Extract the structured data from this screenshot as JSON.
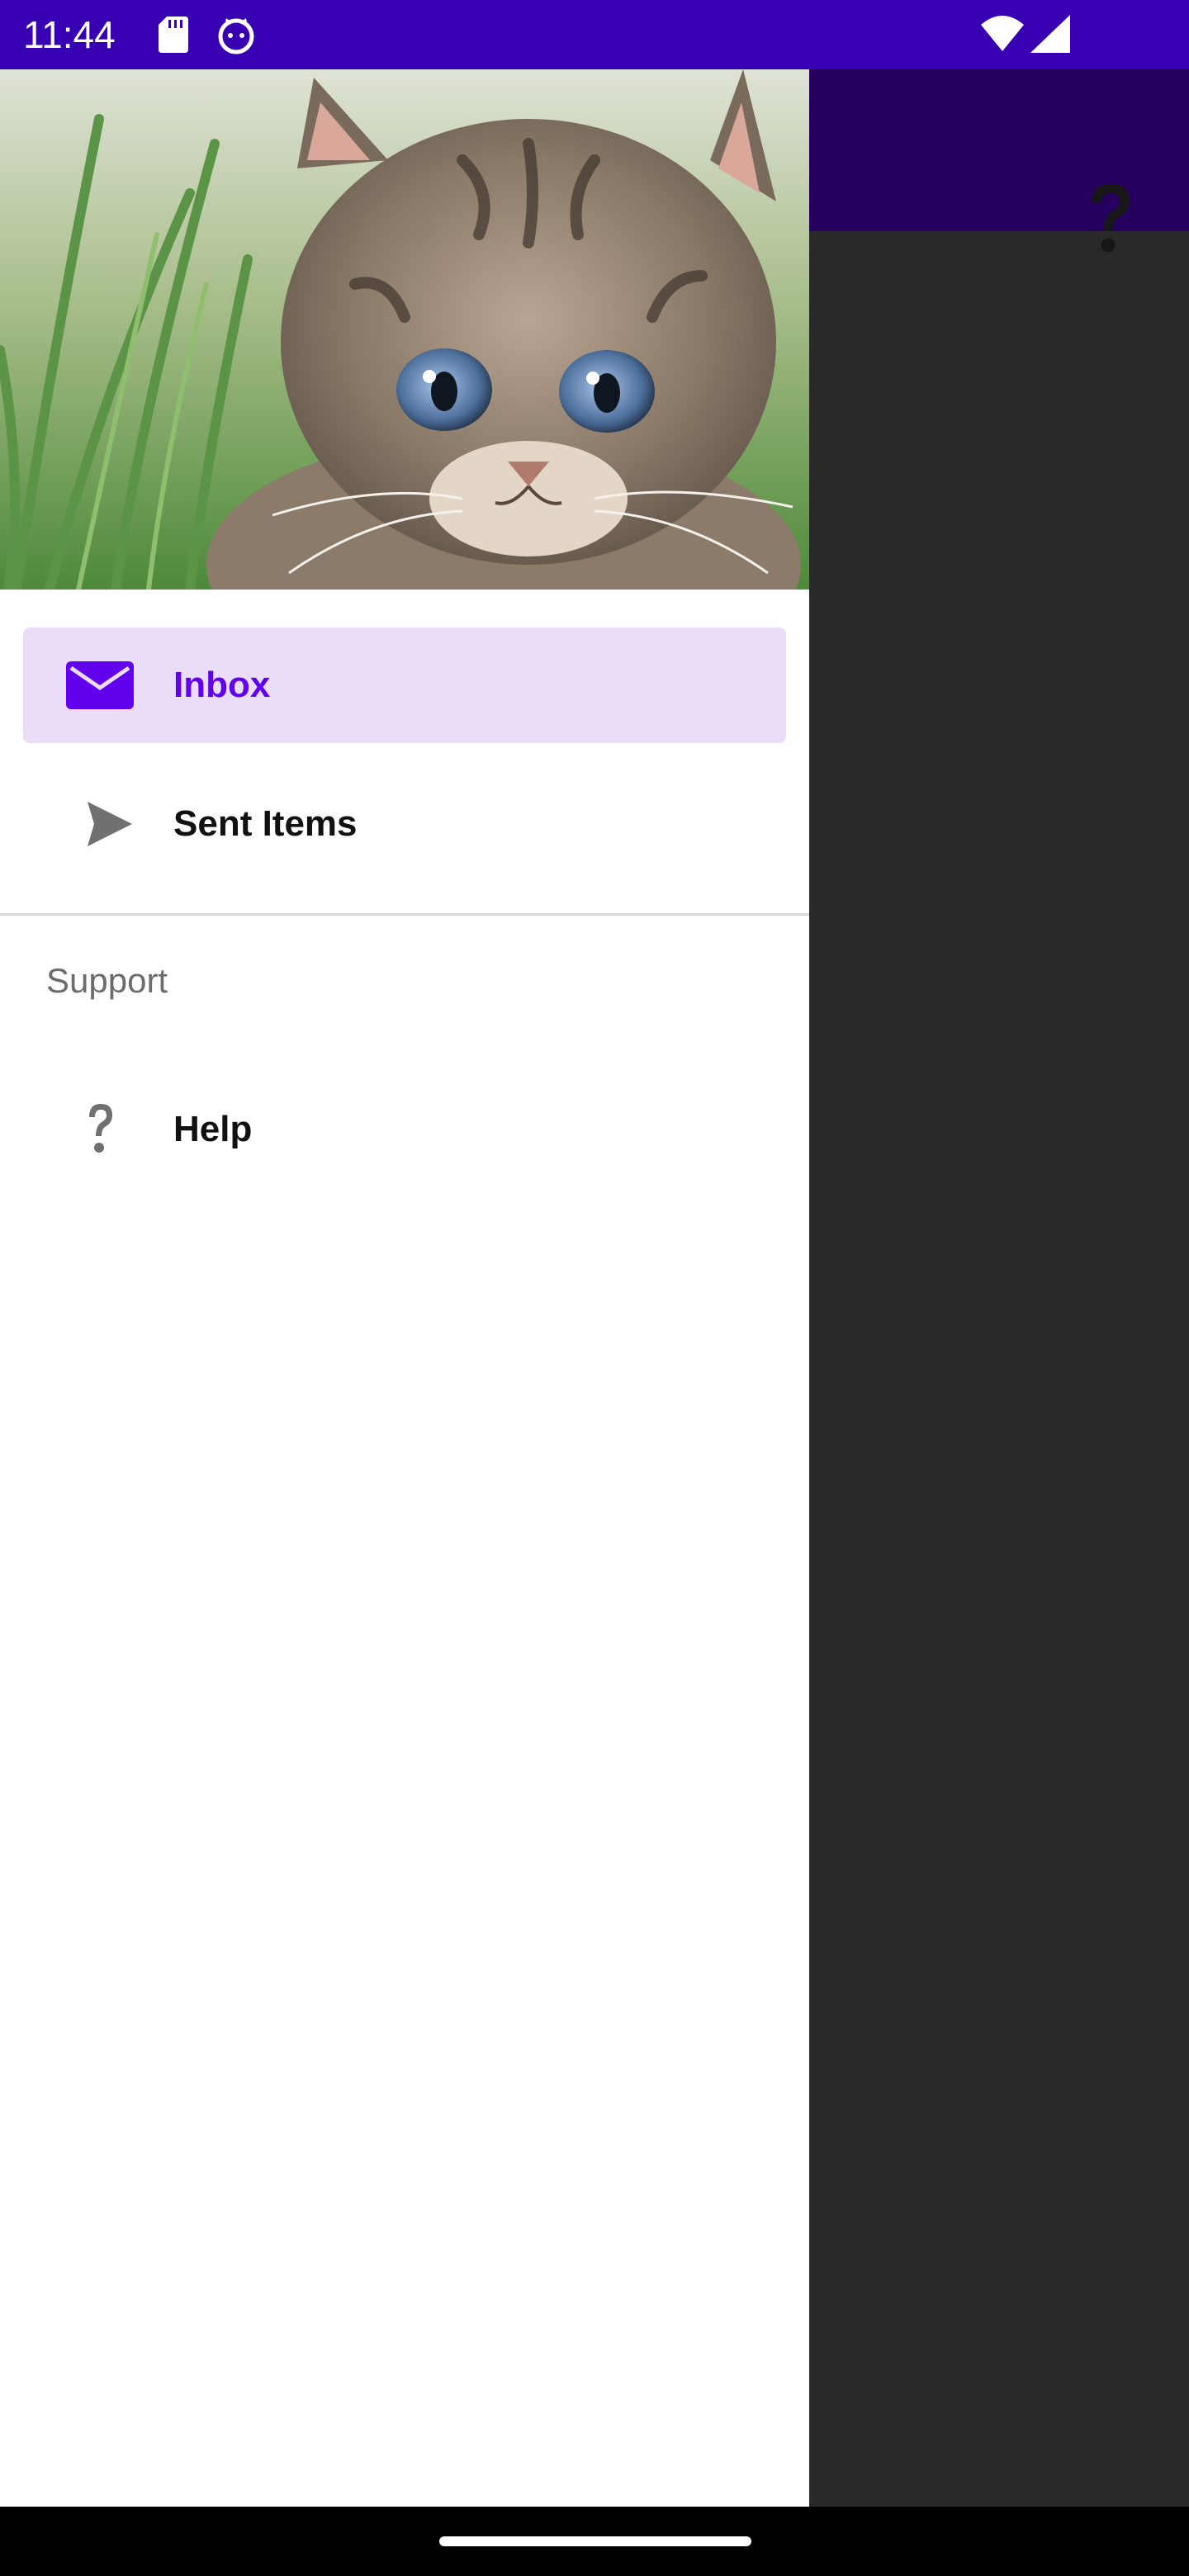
{
  "status_bar": {
    "time": "11:44",
    "icons": [
      "sd-card-icon",
      "android-cat-icon",
      "wifi-icon",
      "cellular-signal-icon"
    ],
    "background": "#3700B3"
  },
  "app_bar": {
    "background": "#6200EE",
    "actions": [
      {
        "icon": "help-icon"
      }
    ]
  },
  "drawer": {
    "header_image": "kitten-photo",
    "items": [
      {
        "label": "Inbox",
        "icon": "mail-icon",
        "selected": true
      },
      {
        "label": "Sent Items",
        "icon": "send-icon",
        "selected": false
      }
    ],
    "sections": [
      {
        "title": "Support",
        "items": [
          {
            "label": "Help",
            "icon": "help-icon",
            "selected": false
          }
        ]
      }
    ],
    "selected_color": "#6200EE",
    "selected_bg": "#EADDF9"
  }
}
